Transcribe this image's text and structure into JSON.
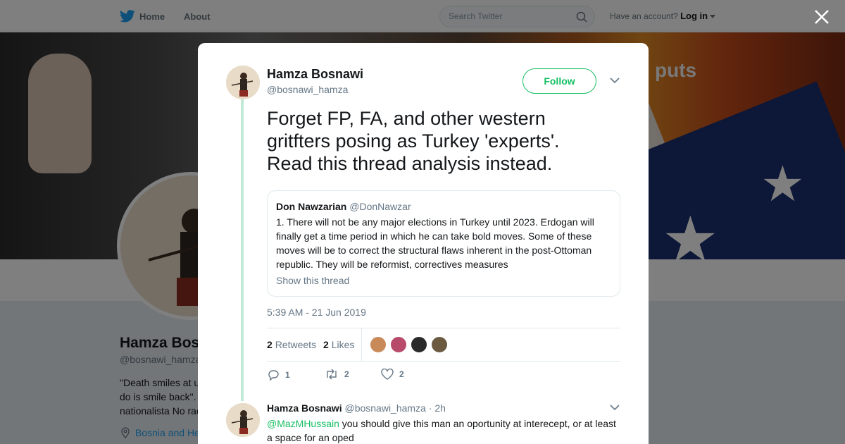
{
  "nav": {
    "home": "Home",
    "about": "About",
    "search_placeholder": "Search Twitter",
    "account_prompt": "Have an account?",
    "login": "Log in"
  },
  "banner": {
    "text": "puts"
  },
  "profile": {
    "name": "Hamza Bos",
    "handle": "@bosnawi_hamza",
    "bio": "\"Death smiles at u\ndo is smile back\".\nnationalista No rac",
    "location": "Bosnia and He"
  },
  "tweet": {
    "author_name": "Hamza Bosnawi",
    "author_handle": "@bosnawi_hamza",
    "follow_label": "Follow",
    "text": "Forget FP, FA, and other western gritfters posing as Turkey 'experts'. Read this thread analysis instead.",
    "quote": {
      "name": "Don Nawzarian",
      "handle": "@DonNawzar",
      "text": "1. There will not be any major elections in Turkey until 2023. Erdogan will finally get a time period in which he can take bold moves. Some of these moves will be to correct the structural flaws inherent in the post-Ottoman republic. They will be reformist, correctives measures",
      "link": "Show this thread"
    },
    "timestamp": "5:39 AM - 21 Jun 2019",
    "retweets_count": "2",
    "retweets_label": "Retweets",
    "likes_count": "2",
    "likes_label": "Likes",
    "liker_colors": [
      "#c98a5a",
      "#b84a6a",
      "#2a2a2a",
      "#6b5a40"
    ],
    "actions": {
      "replies": "1",
      "retweets": "2",
      "likes": "2"
    }
  },
  "reply": {
    "author_name": "Hamza Bosnawi",
    "author_handle": "@bosnawi_hamza",
    "time": "· 2h",
    "mention": "@MazMHussain",
    "text": " you should give this man an oportunity at interecept, or at least a space for an oped"
  },
  "colors": {
    "accent": "#17bf63",
    "link": "#1da1f2",
    "muted": "#657786"
  },
  "icons": [
    "twitter-bird-icon",
    "search-icon",
    "caret-down-icon",
    "close-icon",
    "location-pin-icon",
    "reply-icon",
    "retweet-icon",
    "heart-icon",
    "chevron-down-icon"
  ]
}
